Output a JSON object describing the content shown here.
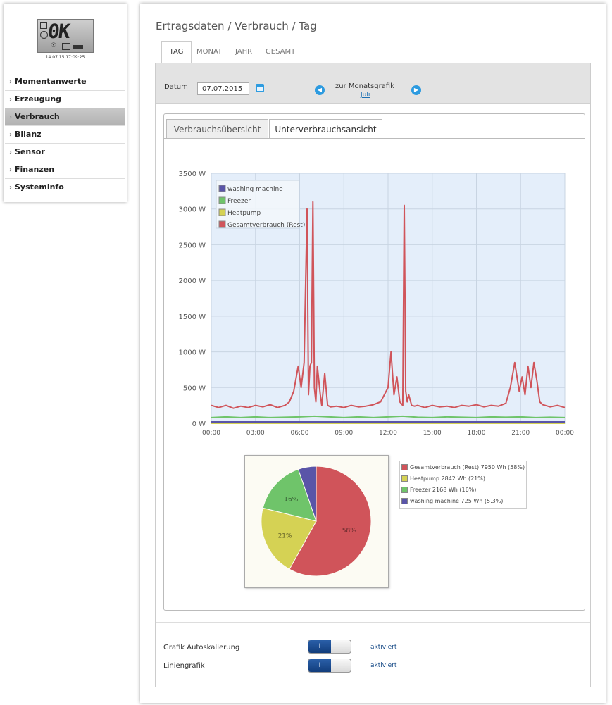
{
  "sidebar": {
    "lcd_text": "0K",
    "lcd_date": "14.07.15 17:09:25",
    "items": [
      {
        "label": "Momentanwerte"
      },
      {
        "label": "Erzeugung"
      },
      {
        "label": "Verbrauch"
      },
      {
        "label": "Bilanz"
      },
      {
        "label": "Sensor"
      },
      {
        "label": "Finanzen"
      },
      {
        "label": "Systeminfo"
      }
    ],
    "active_index": 2
  },
  "breadcrumb": "Ertragsdaten / Verbrauch / Tag",
  "period_tabs": [
    "TAG",
    "MONAT",
    "JAHR",
    "GESAMT"
  ],
  "active_period_tab": "TAG",
  "date_row": {
    "label": "Datum",
    "value": "07.07.2015",
    "month_nav_label": "zur Monatsgrafik",
    "month_link": "Juli"
  },
  "view_tabs": [
    "Verbrauchsübersicht",
    "Unterverbrauchsansicht"
  ],
  "active_view_tab": "Unterverbrauchsansicht",
  "colors": {
    "gesamt": "#d0545a",
    "heatpump": "#d5d254",
    "freezer": "#6fc46a",
    "washing": "#5a55a8",
    "plot_bg": "#e4eefa"
  },
  "chart_data": [
    {
      "type": "line",
      "title": "",
      "xlabel": "",
      "ylabel": "",
      "x_ticks": [
        "00:00",
        "03:00",
        "06:00",
        "09:00",
        "12:00",
        "15:00",
        "18:00",
        "21:00",
        "00:00"
      ],
      "y_ticks": [
        "0 W",
        "500 W",
        "1000 W",
        "1500 W",
        "2000 W",
        "2500 W",
        "3000 W",
        "3500 W"
      ],
      "ylim": [
        0,
        3500
      ],
      "xlim_hours": [
        0,
        24
      ],
      "grid": true,
      "legend_position": "top-left",
      "series": [
        {
          "name": "washing machine",
          "color_key": "washing",
          "x": [
            0,
            24
          ],
          "y": [
            20,
            20
          ]
        },
        {
          "name": "Freezer",
          "color_key": "freezer",
          "x": [
            0,
            1,
            2,
            3,
            4,
            5,
            6,
            7,
            8,
            9,
            10,
            11,
            12,
            13,
            14,
            15,
            16,
            17,
            18,
            19,
            20,
            21,
            22,
            23,
            24
          ],
          "y": [
            80,
            90,
            80,
            90,
            80,
            85,
            90,
            100,
            90,
            80,
            90,
            80,
            90,
            100,
            85,
            80,
            90,
            85,
            80,
            90,
            85,
            90,
            80,
            85,
            80
          ]
        },
        {
          "name": "Heatpump",
          "color_key": "heatpump",
          "x": [
            0,
            24
          ],
          "y": [
            0,
            0
          ]
        },
        {
          "name": "Gesamtverbrauch (Rest)",
          "color_key": "gesamt",
          "x": [
            0,
            0.5,
            1,
            1.5,
            2,
            2.5,
            3,
            3.5,
            4,
            4.5,
            5,
            5.3,
            5.6,
            5.9,
            6.1,
            6.3,
            6.5,
            6.6,
            6.7,
            6.8,
            6.9,
            7.0,
            7.1,
            7.2,
            7.3,
            7.4,
            7.5,
            7.7,
            7.9,
            8.1,
            8.5,
            9,
            9.5,
            10,
            10.5,
            11,
            11.5,
            12,
            12.2,
            12.4,
            12.6,
            12.8,
            13.0,
            13.1,
            13.2,
            13.3,
            13.4,
            13.6,
            13.8,
            14,
            14.5,
            15,
            15.5,
            16,
            16.5,
            17,
            17.5,
            18,
            18.5,
            19,
            19.5,
            20,
            20.3,
            20.6,
            20.9,
            21.1,
            21.3,
            21.5,
            21.7,
            21.9,
            22.1,
            22.3,
            22.5,
            23,
            23.5,
            24
          ],
          "y": [
            250,
            220,
            250,
            210,
            240,
            220,
            250,
            230,
            260,
            220,
            250,
            300,
            450,
            800,
            500,
            850,
            3000,
            400,
            800,
            850,
            3100,
            500,
            300,
            800,
            600,
            400,
            250,
            700,
            250,
            230,
            240,
            220,
            250,
            230,
            240,
            260,
            300,
            500,
            1000,
            400,
            650,
            300,
            250,
            3050,
            450,
            300,
            400,
            250,
            240,
            250,
            220,
            250,
            230,
            240,
            220,
            250,
            240,
            260,
            230,
            250,
            240,
            280,
            500,
            850,
            450,
            650,
            400,
            800,
            500,
            850,
            600,
            300,
            260,
            230,
            250,
            220
          ]
        }
      ]
    },
    {
      "type": "pie",
      "title": "",
      "slices": [
        {
          "name": "Gesamtverbrauch (Rest)",
          "value": 7950,
          "unit": "Wh",
          "percent": 58,
          "label": "58%",
          "legend": "Gesamtverbrauch (Rest) 7950 Wh (58%)",
          "color_key": "gesamt"
        },
        {
          "name": "Heatpump",
          "value": 2842,
          "unit": "Wh",
          "percent": 21,
          "label": "21%",
          "legend": "Heatpump 2842 Wh (21%)",
          "color_key": "heatpump"
        },
        {
          "name": "Freezer",
          "value": 2168,
          "unit": "Wh",
          "percent": 16,
          "label": "16%",
          "legend": "Freezer 2168 Wh (16%)",
          "color_key": "freezer"
        },
        {
          "name": "washing machine",
          "value": 725,
          "unit": "Wh",
          "percent": 5.3,
          "label": "",
          "legend": "washing machine 725 Wh (5.3%)",
          "color_key": "washing"
        }
      ],
      "legend_position": "right"
    }
  ],
  "settings": [
    {
      "label": "Grafik Autoskalierung",
      "toggle_text": "I",
      "status": "aktiviert"
    },
    {
      "label": "Liniengrafik",
      "toggle_text": "I",
      "status": "aktiviert"
    }
  ]
}
